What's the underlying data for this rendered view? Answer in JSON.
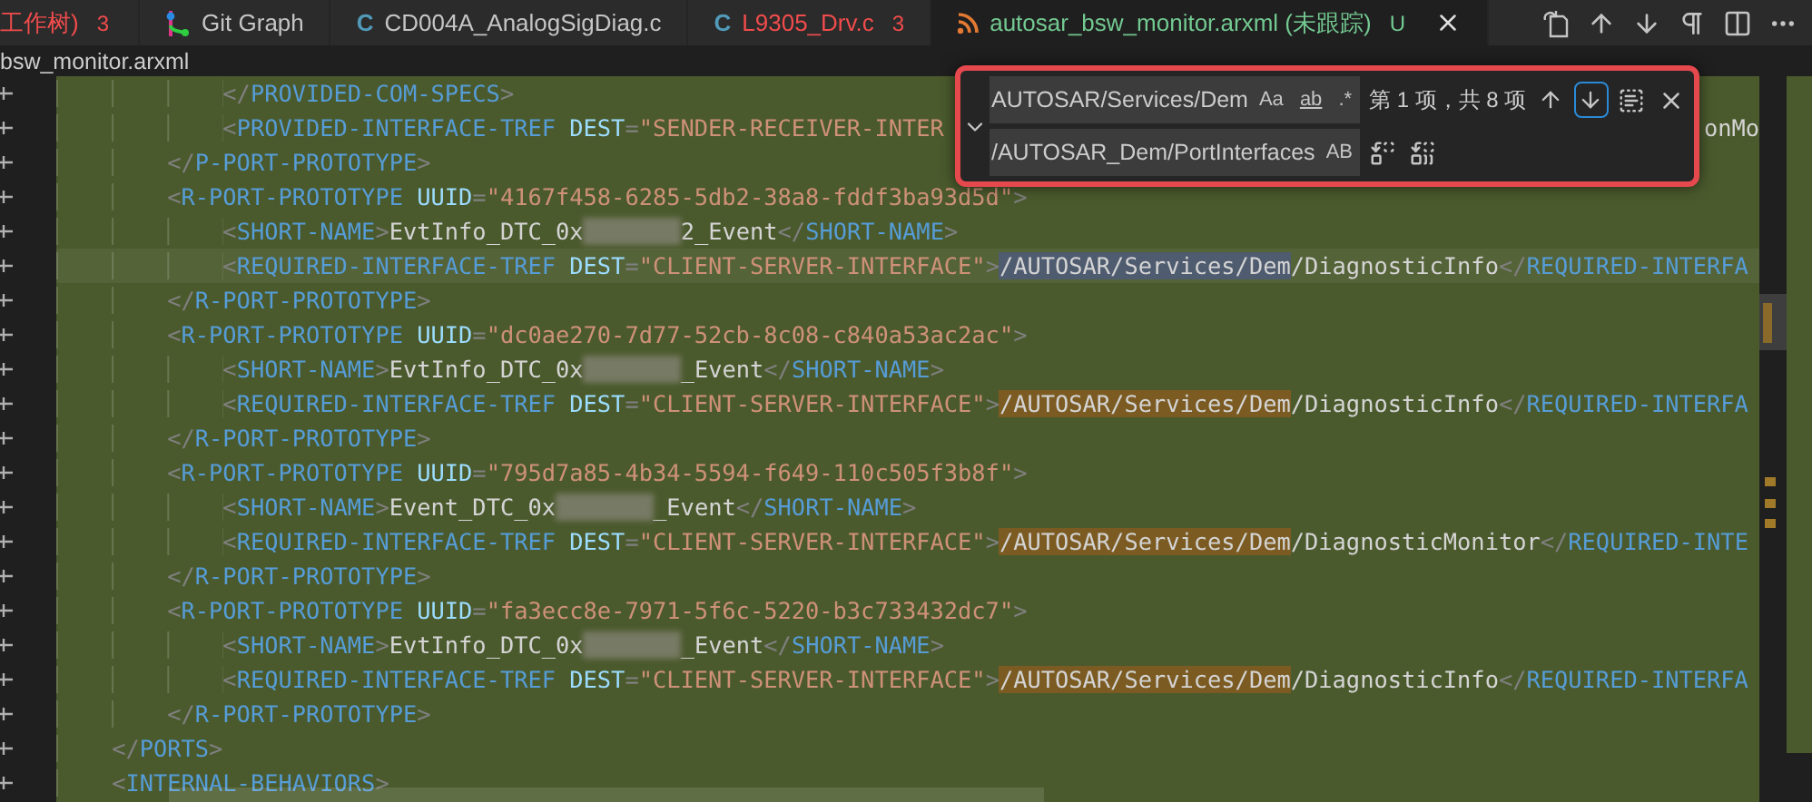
{
  "tabs": [
    {
      "label": "工作树)",
      "badge": "3",
      "kind": "plain",
      "color": "#f14c4c",
      "selected": false
    },
    {
      "label": "Git Graph",
      "kind": "git",
      "color": "#c5c5c5",
      "selected": false
    },
    {
      "label": "CD004A_AnalogSigDiag.c",
      "kind": "c",
      "icon_text": "C",
      "color": "#c5c5c5",
      "selected": false
    },
    {
      "label": "L9305_Drv.c",
      "badge": "3",
      "kind": "c",
      "icon_text": "C",
      "color": "#f14c4c",
      "selected": false
    },
    {
      "label": "autosar_bsw_monitor.arxml (未跟踪)",
      "badge": "U",
      "kind": "feed",
      "color": "#73c991",
      "selected": true
    }
  ],
  "breadcrumb": "bsw_monitor.arxml",
  "find": {
    "value": "AUTOSAR/Services/Dem",
    "options": [
      {
        "text": "Aa",
        "on": false
      },
      {
        "text": "ab",
        "on": false
      },
      {
        "text": ".*",
        "on": false
      }
    ],
    "count": "第 1 项，共 8 项",
    "nav": [
      {
        "kind": "previous",
        "focused": false
      },
      {
        "kind": "next",
        "focused": true
      }
    ],
    "replace_value": "/AUTOSAR_Dem/PortInterfaces",
    "replace_options": [
      {
        "text": "AB",
        "on": false
      }
    ]
  },
  "lines": [
    {
      "current": false,
      "tokens": [
        {
          "kind": "punct",
          "text": "            </"
        },
        {
          "kind": "tag",
          "text": "PROVIDED-COM-SPECS"
        },
        {
          "kind": "punct",
          "text": ">"
        }
      ]
    },
    {
      "current": false,
      "tail": "onMo",
      "tokens": [
        {
          "kind": "punct",
          "text": "            <"
        },
        {
          "kind": "tag",
          "text": "PROVIDED-INTERFACE-TREF"
        },
        {
          "kind": "attr",
          "text": " DEST"
        },
        {
          "kind": "punct",
          "text": "="
        },
        {
          "kind": "string",
          "text": "\"SENDER-RECEIVER-INTER"
        }
      ]
    },
    {
      "current": false,
      "tokens": [
        {
          "kind": "punct",
          "text": "        </"
        },
        {
          "kind": "tag",
          "text": "P-PORT-PROTOTYPE"
        },
        {
          "kind": "punct",
          "text": ">"
        }
      ]
    },
    {
      "current": false,
      "tokens": [
        {
          "kind": "punct",
          "text": "        <"
        },
        {
          "kind": "tag",
          "text": "R-PORT-PROTOTYPE"
        },
        {
          "kind": "attr",
          "text": " UUID"
        },
        {
          "kind": "punct",
          "text": "="
        },
        {
          "kind": "string",
          "text": "\"4167f458-6285-5db2-38a8-fddf3ba93d5d\""
        },
        {
          "kind": "punct",
          "text": ">"
        }
      ]
    },
    {
      "current": false,
      "tokens": [
        {
          "kind": "punct",
          "text": "            <"
        },
        {
          "kind": "tag",
          "text": "SHORT-NAME"
        },
        {
          "kind": "punct",
          "text": ">"
        },
        {
          "kind": "text",
          "text": "EvtInfo_DTC_0x"
        },
        {
          "kind": "redacted"
        },
        {
          "kind": "text",
          "text": "2_Event"
        },
        {
          "kind": "punct",
          "text": "</"
        },
        {
          "kind": "tag",
          "text": "SHORT-NAME"
        },
        {
          "kind": "punct",
          "text": ">"
        }
      ]
    },
    {
      "current": true,
      "tokens": [
        {
          "kind": "punct",
          "text": "            <"
        },
        {
          "kind": "tag",
          "text": "REQUIRED-INTERFACE-TREF"
        },
        {
          "kind": "attr",
          "text": " DEST"
        },
        {
          "kind": "punct",
          "text": "="
        },
        {
          "kind": "string",
          "text": "\"CLIENT-SERVER-INTERFACE\""
        },
        {
          "kind": "punct",
          "text": ">"
        },
        {
          "kind": "match",
          "selected": true,
          "text": "/AUTOSAR/Services/Dem"
        },
        {
          "kind": "text",
          "text": "/DiagnosticInfo"
        },
        {
          "kind": "punct",
          "text": "</"
        },
        {
          "kind": "tag",
          "text": "REQUIRED-INTERFA"
        }
      ]
    },
    {
      "current": false,
      "tokens": [
        {
          "kind": "punct",
          "text": "        </"
        },
        {
          "kind": "tag",
          "text": "R-PORT-PROTOTYPE"
        },
        {
          "kind": "punct",
          "text": ">"
        }
      ]
    },
    {
      "current": false,
      "tokens": [
        {
          "kind": "punct",
          "text": "        <"
        },
        {
          "kind": "tag",
          "text": "R-PORT-PROTOTYPE"
        },
        {
          "kind": "attr",
          "text": " UUID"
        },
        {
          "kind": "punct",
          "text": "="
        },
        {
          "kind": "string",
          "text": "\"dc0ae270-7d77-52cb-8c08-c840a53ac2ac\""
        },
        {
          "kind": "punct",
          "text": ">"
        }
      ]
    },
    {
      "current": false,
      "tokens": [
        {
          "kind": "punct",
          "text": "            <"
        },
        {
          "kind": "tag",
          "text": "SHORT-NAME"
        },
        {
          "kind": "punct",
          "text": ">"
        },
        {
          "kind": "text",
          "text": "EvtInfo_DTC_0x"
        },
        {
          "kind": "redacted"
        },
        {
          "kind": "text",
          "text": "_Event"
        },
        {
          "kind": "punct",
          "text": "</"
        },
        {
          "kind": "tag",
          "text": "SHORT-NAME"
        },
        {
          "kind": "punct",
          "text": ">"
        }
      ]
    },
    {
      "current": false,
      "tokens": [
        {
          "kind": "punct",
          "text": "            <"
        },
        {
          "kind": "tag",
          "text": "REQUIRED-INTERFACE-TREF"
        },
        {
          "kind": "attr",
          "text": " DEST"
        },
        {
          "kind": "punct",
          "text": "="
        },
        {
          "kind": "string",
          "text": "\"CLIENT-SERVER-INTERFACE\""
        },
        {
          "kind": "punct",
          "text": ">"
        },
        {
          "kind": "match",
          "selected": false,
          "text": "/AUTOSAR/Services/Dem"
        },
        {
          "kind": "text",
          "text": "/DiagnosticInfo"
        },
        {
          "kind": "punct",
          "text": "</"
        },
        {
          "kind": "tag",
          "text": "REQUIRED-INTERFA"
        }
      ]
    },
    {
      "current": false,
      "tokens": [
        {
          "kind": "punct",
          "text": "        </"
        },
        {
          "kind": "tag",
          "text": "R-PORT-PROTOTYPE"
        },
        {
          "kind": "punct",
          "text": ">"
        }
      ]
    },
    {
      "current": false,
      "tokens": [
        {
          "kind": "punct",
          "text": "        <"
        },
        {
          "kind": "tag",
          "text": "R-PORT-PROTOTYPE"
        },
        {
          "kind": "attr",
          "text": " UUID"
        },
        {
          "kind": "punct",
          "text": "="
        },
        {
          "kind": "string",
          "text": "\"795d7a85-4b34-5594-f649-110c505f3b8f\""
        },
        {
          "kind": "punct",
          "text": ">"
        }
      ]
    },
    {
      "current": false,
      "tokens": [
        {
          "kind": "punct",
          "text": "            <"
        },
        {
          "kind": "tag",
          "text": "SHORT-NAME"
        },
        {
          "kind": "punct",
          "text": ">"
        },
        {
          "kind": "text",
          "text": "Event_DTC_0x"
        },
        {
          "kind": "redacted"
        },
        {
          "kind": "text",
          "text": "_Event"
        },
        {
          "kind": "punct",
          "text": "</"
        },
        {
          "kind": "tag",
          "text": "SHORT-NAME"
        },
        {
          "kind": "punct",
          "text": ">"
        }
      ]
    },
    {
      "current": false,
      "tokens": [
        {
          "kind": "punct",
          "text": "            <"
        },
        {
          "kind": "tag",
          "text": "REQUIRED-INTERFACE-TREF"
        },
        {
          "kind": "attr",
          "text": " DEST"
        },
        {
          "kind": "punct",
          "text": "="
        },
        {
          "kind": "string",
          "text": "\"CLIENT-SERVER-INTERFACE\""
        },
        {
          "kind": "punct",
          "text": ">"
        },
        {
          "kind": "match",
          "selected": false,
          "text": "/AUTOSAR/Services/Dem"
        },
        {
          "kind": "text",
          "text": "/DiagnosticMonitor"
        },
        {
          "kind": "punct",
          "text": "</"
        },
        {
          "kind": "tag",
          "text": "REQUIRED-INTE"
        }
      ]
    },
    {
      "current": false,
      "tokens": [
        {
          "kind": "punct",
          "text": "        </"
        },
        {
          "kind": "tag",
          "text": "R-PORT-PROTOTYPE"
        },
        {
          "kind": "punct",
          "text": ">"
        }
      ]
    },
    {
      "current": false,
      "tokens": [
        {
          "kind": "punct",
          "text": "        <"
        },
        {
          "kind": "tag",
          "text": "R-PORT-PROTOTYPE"
        },
        {
          "kind": "attr",
          "text": " UUID"
        },
        {
          "kind": "punct",
          "text": "="
        },
        {
          "kind": "string",
          "text": "\"fa3ecc8e-7971-5f6c-5220-b3c733432dc7\""
        },
        {
          "kind": "punct",
          "text": ">"
        }
      ]
    },
    {
      "current": false,
      "tokens": [
        {
          "kind": "punct",
          "text": "            <"
        },
        {
          "kind": "tag",
          "text": "SHORT-NAME"
        },
        {
          "kind": "punct",
          "text": ">"
        },
        {
          "kind": "text",
          "text": "EvtInfo_DTC_0x"
        },
        {
          "kind": "redacted"
        },
        {
          "kind": "text",
          "text": "_Event"
        },
        {
          "kind": "punct",
          "text": "</"
        },
        {
          "kind": "tag",
          "text": "SHORT-NAME"
        },
        {
          "kind": "punct",
          "text": ">"
        }
      ]
    },
    {
      "current": false,
      "tokens": [
        {
          "kind": "punct",
          "text": "            <"
        },
        {
          "kind": "tag",
          "text": "REQUIRED-INTERFACE-TREF"
        },
        {
          "kind": "attr",
          "text": " DEST"
        },
        {
          "kind": "punct",
          "text": "="
        },
        {
          "kind": "string",
          "text": "\"CLIENT-SERVER-INTERFACE\""
        },
        {
          "kind": "punct",
          "text": ">"
        },
        {
          "kind": "match",
          "selected": false,
          "text": "/AUTOSAR/Services/Dem"
        },
        {
          "kind": "text",
          "text": "/DiagnosticInfo"
        },
        {
          "kind": "punct",
          "text": "</"
        },
        {
          "kind": "tag",
          "text": "REQUIRED-INTERFA"
        }
      ]
    },
    {
      "current": false,
      "tokens": [
        {
          "kind": "punct",
          "text": "        </"
        },
        {
          "kind": "tag",
          "text": "R-PORT-PROTOTYPE"
        },
        {
          "kind": "punct",
          "text": ">"
        }
      ]
    },
    {
      "current": false,
      "tokens": [
        {
          "kind": "punct",
          "text": "    </"
        },
        {
          "kind": "tag",
          "text": "PORTS"
        },
        {
          "kind": "punct",
          "text": ">"
        }
      ]
    },
    {
      "current": false,
      "tokens": [
        {
          "kind": "punct",
          "text": "    <"
        },
        {
          "kind": "tag",
          "text": "INTERNAL-BEHAVIORS"
        },
        {
          "kind": "punct",
          "text": ">"
        }
      ]
    }
  ]
}
